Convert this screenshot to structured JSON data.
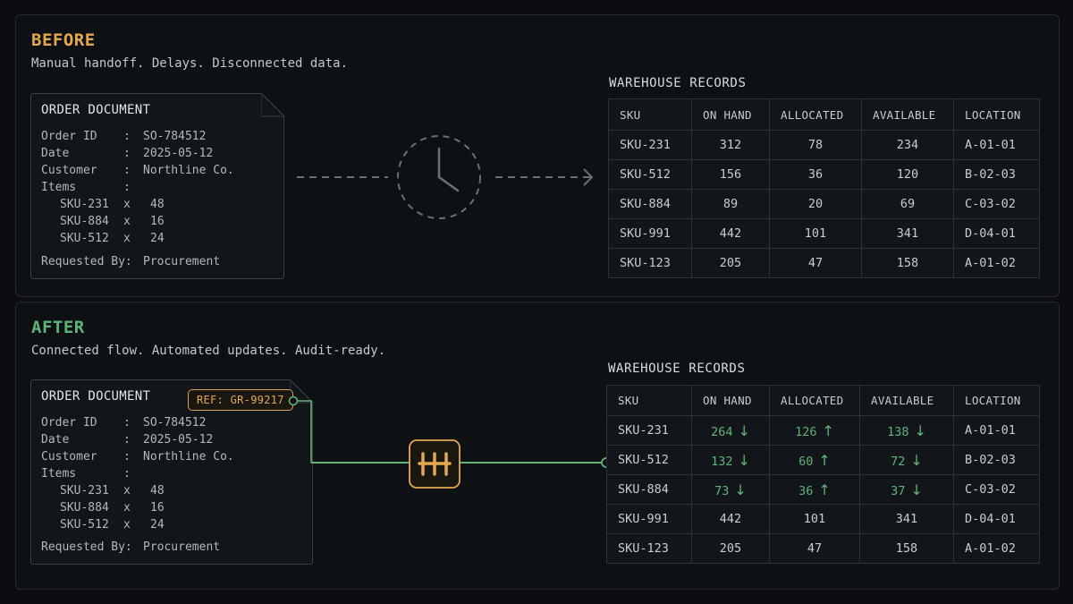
{
  "before": {
    "heading": "BEFORE",
    "subtitle": "Manual handoff. Delays. Disconnected data.",
    "heading_color": "#e3a84f",
    "document": {
      "title": "ORDER DOCUMENT",
      "order_id_label": "Order ID",
      "order_id": "SO-784512",
      "date_label": "Date",
      "date": "2025-05-12",
      "customer_label": "Customer",
      "customer": "Northline Co.",
      "items_label": "Items",
      "items": [
        {
          "sku": "SKU-231",
          "x": "x",
          "qty": "48"
        },
        {
          "sku": "SKU-884",
          "x": "x",
          "qty": "16"
        },
        {
          "sku": "SKU-512",
          "x": "x",
          "qty": "24"
        }
      ],
      "requested_by_label": "Requested By:",
      "requested_by": "Procurement"
    },
    "connector_icon": "clock-icon",
    "table": {
      "label": "WAREHOUSE RECORDS",
      "headers": [
        "SKU",
        "ON HAND",
        "ALLOCATED",
        "AVAILABLE",
        "LOCATION"
      ],
      "rows": [
        {
          "sku": "SKU-231",
          "on_hand": "312",
          "allocated": "78",
          "available": "234",
          "location": "A-01-01"
        },
        {
          "sku": "SKU-512",
          "on_hand": "156",
          "allocated": "36",
          "available": "120",
          "location": "B-02-03"
        },
        {
          "sku": "SKU-884",
          "on_hand": "89",
          "allocated": "20",
          "available": "69",
          "location": "C-03-02"
        },
        {
          "sku": "SKU-991",
          "on_hand": "442",
          "allocated": "101",
          "available": "341",
          "location": "D-04-01"
        },
        {
          "sku": "SKU-123",
          "on_hand": "205",
          "allocated": "47",
          "available": "158",
          "location": "A-01-02"
        }
      ]
    }
  },
  "after": {
    "heading": "AFTER",
    "subtitle": "Connected flow. Automated updates. Audit-ready.",
    "heading_color": "#5fb37a",
    "ref": "REF: GR-99217",
    "document": {
      "title": "ORDER DOCUMENT",
      "order_id_label": "Order ID",
      "order_id": "SO-784512",
      "date_label": "Date",
      "date": "2025-05-12",
      "customer_label": "Customer",
      "customer": "Northline Co.",
      "items_label": "Items",
      "items": [
        {
          "sku": "SKU-231",
          "x": "x",
          "qty": "48"
        },
        {
          "sku": "SKU-884",
          "x": "x",
          "qty": "16"
        },
        {
          "sku": "SKU-512",
          "x": "x",
          "qty": "24"
        }
      ],
      "requested_by_label": "Requested By:",
      "requested_by": "Procurement"
    },
    "connector_icon": "integration-hub-icon",
    "table": {
      "label": "WAREHOUSE RECORDS",
      "headers": [
        "SKU",
        "ON HAND",
        "ALLOCATED",
        "AVAILABLE",
        "LOCATION"
      ],
      "rows": [
        {
          "sku": "SKU-231",
          "on_hand": "264",
          "on_hand_dir": "down",
          "allocated": "126",
          "allocated_dir": "up",
          "available": "138",
          "available_dir": "down",
          "location": "A-01-01"
        },
        {
          "sku": "SKU-512",
          "on_hand": "132",
          "on_hand_dir": "down",
          "allocated": "60",
          "allocated_dir": "up",
          "available": "72",
          "available_dir": "down",
          "location": "B-02-03"
        },
        {
          "sku": "SKU-884",
          "on_hand": "73",
          "on_hand_dir": "down",
          "allocated": "36",
          "allocated_dir": "up",
          "available": "37",
          "available_dir": "down",
          "location": "C-03-02"
        },
        {
          "sku": "SKU-991",
          "on_hand": "442",
          "allocated": "101",
          "available": "341",
          "location": "D-04-01"
        },
        {
          "sku": "SKU-123",
          "on_hand": "205",
          "allocated": "47",
          "available": "158",
          "location": "A-01-02"
        }
      ]
    }
  },
  "colors": {
    "accent_orange": "#e3a84f",
    "accent_green": "#5fb37a",
    "muted": "#6b7077"
  }
}
